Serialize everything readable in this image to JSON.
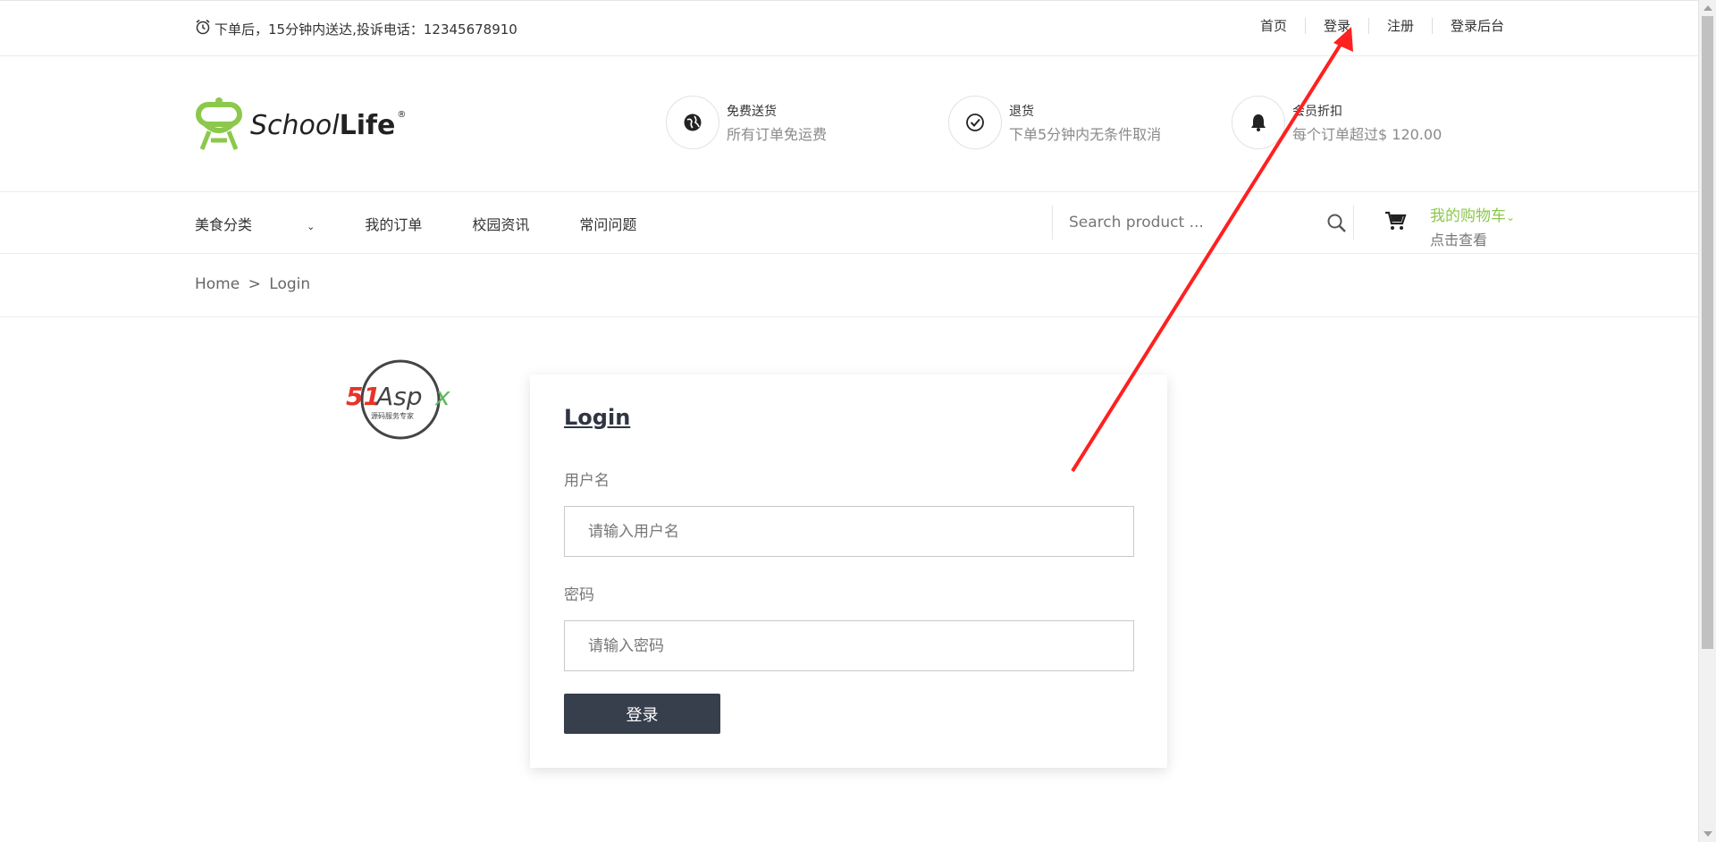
{
  "topbar": {
    "notice": "下单后，15分钟内送达,投诉电话：12345678910",
    "links": [
      "首页",
      "登录",
      "注册",
      "登录后台"
    ]
  },
  "header": {
    "logo": {
      "name_italic": "School",
      "name_bold": "Life",
      "reg": "®"
    },
    "features": [
      {
        "icon": "globe-icon",
        "title": "免费送货",
        "desc": "所有订单免运费"
      },
      {
        "icon": "check-circle-icon",
        "title": "退货",
        "desc": "下单5分钟内无条件取消"
      },
      {
        "icon": "bell-icon",
        "title": "会员折扣",
        "desc": "每个订单超过$ 120.00"
      }
    ]
  },
  "nav": {
    "items": [
      "美食分类",
      "我的订单",
      "校园资讯",
      "常问问题"
    ],
    "search_placeholder": "Search product ...",
    "cart_title": "我的购物车",
    "cart_sub": "点击查看"
  },
  "breadcrumb": {
    "home": "Home",
    "sep": ">",
    "current": "Login"
  },
  "watermark": {
    "text": "51Aspx",
    "sub": "源码服务专家"
  },
  "login": {
    "title": "Login",
    "username_label": "用户名",
    "username_placeholder": "请输入用户名",
    "password_label": "密码",
    "password_placeholder": "请输入密码",
    "submit_label": "登录"
  },
  "colors": {
    "accent": "#8cc84b",
    "button": "#373e4c",
    "annotation_arrow": "#ff2020"
  }
}
